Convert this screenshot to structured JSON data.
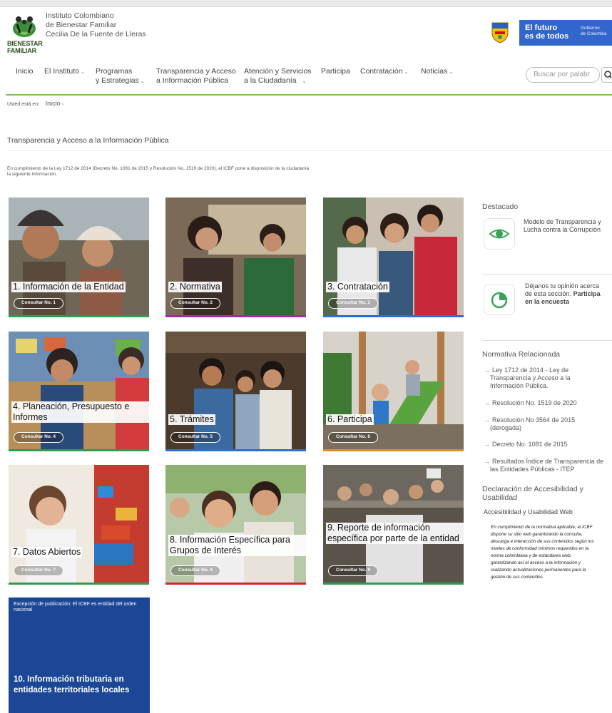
{
  "header": {
    "institution_lines": [
      "Instituto Colombiano",
      "de Bienestar Familiar",
      "Cecilia De la Fuente de Lleras"
    ],
    "logo_text_line1": "BIENESTAR",
    "logo_text_line2": "FAMILIAR",
    "gov_banner_line1": "El futuro",
    "gov_banner_line2": "es de todos",
    "gov_banner_small1": "Gobierno",
    "gov_banner_small2": "de Colombia",
    "colors": {
      "gov_blue": "#3366cc",
      "accent_green": "#7cc35a"
    }
  },
  "nav": {
    "items": [
      {
        "label1": "Inicio",
        "label2": "",
        "caret": false
      },
      {
        "label1": "El Instituto",
        "label2": "",
        "caret": true
      },
      {
        "label1": "Programas",
        "label2": "y Estrategias",
        "caret": true
      },
      {
        "label1": "Transparencia y Acceso",
        "label2": "a Información Pública",
        "caret": false
      },
      {
        "label1": "Atención y Servicios",
        "label2": "a la Ciudadanía",
        "caret": true
      },
      {
        "label1": "Participa",
        "label2": "",
        "caret": false
      },
      {
        "label1": "Contratación",
        "label2": "",
        "caret": true
      },
      {
        "label1": "Noticias",
        "label2": "",
        "caret": true
      }
    ],
    "search_placeholder": "Buscar por palabr"
  },
  "breadcrumb": {
    "label": "Usted está en:",
    "current": "Inicio"
  },
  "page": {
    "title": "Transparencia y Acceso a la Información Pública",
    "intro_line1": "En cumplimiento de la Ley 1712 de 2014 (Decreto No. 1081 de 2015 y Resolución No. 1519 de 2020), el ICBF pone a disposición de la ciudadanía",
    "intro_line2": "la siguiente información."
  },
  "cards": [
    {
      "title": "1. Información de la Entidad",
      "button": "Consultar No. 1",
      "bar_color": "#2e9b4f",
      "photo_icon": "family-photo"
    },
    {
      "title": "2. Normativa",
      "button": "Consultar No. 2",
      "bar_color": "#9b2fa0",
      "photo_icon": "family-photo"
    },
    {
      "title": "3. Contratación",
      "button": "Consultar No. 3",
      "bar_color": "#2c6fd1",
      "photo_icon": "family-photo"
    },
    {
      "title": "4. Planeación, Presupuesto e Informes",
      "button": "Consultar No. 4",
      "bar_color": "#2e9b4f",
      "photo_icon": "children-photo"
    },
    {
      "title": "5. Trámites",
      "button": "Consultar No. 5",
      "bar_color": "#2c6fd1",
      "photo_icon": "children-photo"
    },
    {
      "title": "6. Participa",
      "button": "Consultar No. 6",
      "bar_color": "#e58a1f",
      "photo_icon": "playground-photo"
    },
    {
      "title": "7. Datos Abiertos",
      "button": "Consultar No. 7",
      "bar_color": "#2e9b4f",
      "photo_icon": "child-playing-photo"
    },
    {
      "title": "8. Información Específica para Grupos de Interés",
      "button": "Consultar No. 8",
      "bar_color": "#d8232a",
      "photo_icon": "children-photo"
    },
    {
      "title": "9. Reporte de información específica por parte de la entidad",
      "button": "Consultar No. 9",
      "bar_color": "#2e9b4f",
      "photo_icon": "crowd-photo"
    }
  ],
  "tax_card": {
    "exception": "Excepción de publicación: El ICBF es entidad del orden nacional",
    "title": "10. Información tributaria en entidades territoriales locales",
    "color": "#1b4796"
  },
  "sidebar": {
    "destacado_heading": "Destacado",
    "featured_1_line1": "Modelo de Transparencia y",
    "featured_1_line2": "Lucha contra la Corrupción",
    "featured_2_line1": "Déjanos tu opinión acerca",
    "featured_2_line2": "de esta sección.",
    "featured_2_bold1": "Participa",
    "featured_2_bold2": "en la encuesta",
    "normativa_heading": "Normativa Relacionada",
    "related": [
      {
        "line1": "Ley 1712 de 2014 - Ley de",
        "line2": "Transparencia y Acceso a la",
        "line3": "Información Pública."
      },
      {
        "line1": "Resolución No. 1519 de 2020",
        "line2": "",
        "line3": ""
      },
      {
        "line1": "Resolución No 3564 de 2015",
        "line2": "(derogada)",
        "line3": ""
      },
      {
        "line1": "Decreto No. 1081 de 2015",
        "line2": "",
        "line3": ""
      },
      {
        "line1": "Resultados Índice de Transparencia de",
        "line2": "las Entidades Públicas - ITEP",
        "line3": ""
      }
    ],
    "accesibilidad_heading1": "Declaración de Accesibilidad y",
    "accesibilidad_heading2": "Usabilidad",
    "accesibilidad_sub": "Accesibilidad y Usabilidad Web",
    "accesibilidad_lines": [
      "En cumplimiento de la normativa aplicable, el ICBF",
      "dispone su sitio web garantizando la consulta,",
      "descarga e interacción de sus contenidos según los",
      "niveles de conformidad mínimos requeridos en la",
      "norma colombiana y de estándares web,",
      "garantizando así el acceso a la información y",
      "realizando actualizaciones permanentes para la",
      "gestión de sus contenidos."
    ]
  }
}
